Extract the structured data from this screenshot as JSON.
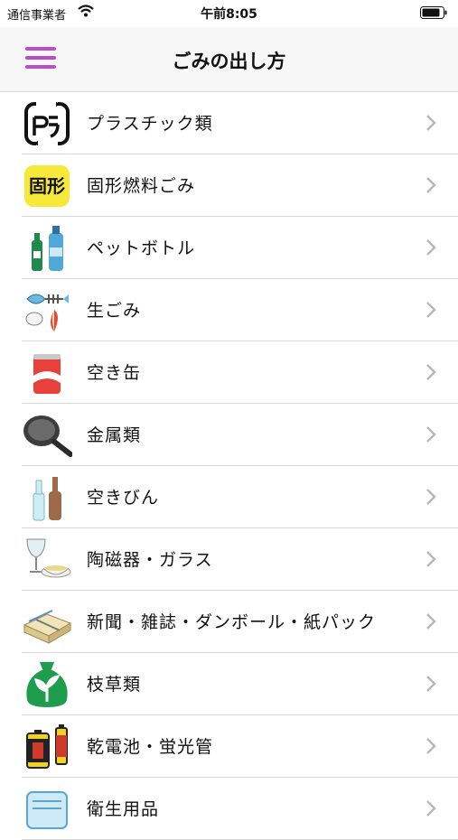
{
  "status_bar": {
    "carrier": "通信事業者",
    "time": "午前8:05"
  },
  "nav": {
    "title": "ごみの出し方"
  },
  "items": [
    {
      "label": "プラスチック類",
      "icon": "plastic-recycle-icon"
    },
    {
      "label": "固形燃料ごみ",
      "icon": "solid-fuel-icon"
    },
    {
      "label": "ペットボトル",
      "icon": "pet-bottle-icon"
    },
    {
      "label": "生ごみ",
      "icon": "food-waste-icon"
    },
    {
      "label": "空き缶",
      "icon": "can-icon"
    },
    {
      "label": "金属類",
      "icon": "frying-pan-icon"
    },
    {
      "label": "空きびん",
      "icon": "glass-bottle-icon"
    },
    {
      "label": "陶磁器・ガラス",
      "icon": "ceramics-glass-icon"
    },
    {
      "label": "新聞・雑誌・ダンボール・紙パック",
      "icon": "newspaper-bundle-icon"
    },
    {
      "label": "枝草類",
      "icon": "grass-bag-icon"
    },
    {
      "label": "乾電池・蛍光管",
      "icon": "battery-icon"
    },
    {
      "label": "衛生用品",
      "icon": "sanitary-icon"
    }
  ],
  "colors": {
    "menu_accent": "#b44fc4",
    "solid_fuel_badge": "#f7e93a"
  }
}
